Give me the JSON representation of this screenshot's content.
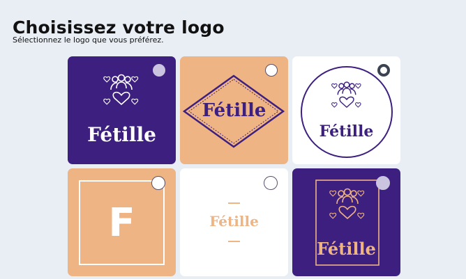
{
  "header": {
    "title": "Choisissez votre logo",
    "subtitle": "Sélectionnez le logo que vous préférez."
  },
  "colors": {
    "purple": "#3d1f80",
    "peach": "#efb483",
    "white": "#ffffff",
    "background": "#e9eef5"
  },
  "logos": [
    {
      "id": "logo-1",
      "brand": "Fétille",
      "style": "purple-icon-stacked",
      "selected": false
    },
    {
      "id": "logo-2",
      "brand": "Fétille",
      "style": "peach-diamond-badge",
      "selected": false
    },
    {
      "id": "logo-3",
      "brand": "Fétille",
      "style": "white-circle-emblem",
      "selected": true
    },
    {
      "id": "logo-4",
      "letter": "F",
      "style": "peach-monogram-frame",
      "selected": false
    },
    {
      "id": "logo-5",
      "brand": "Fétille",
      "style": "white-minimal-wordmark",
      "selected": false
    },
    {
      "id": "logo-6",
      "brand": "Fétille",
      "style": "purple-framed-emblem",
      "selected": false
    }
  ]
}
